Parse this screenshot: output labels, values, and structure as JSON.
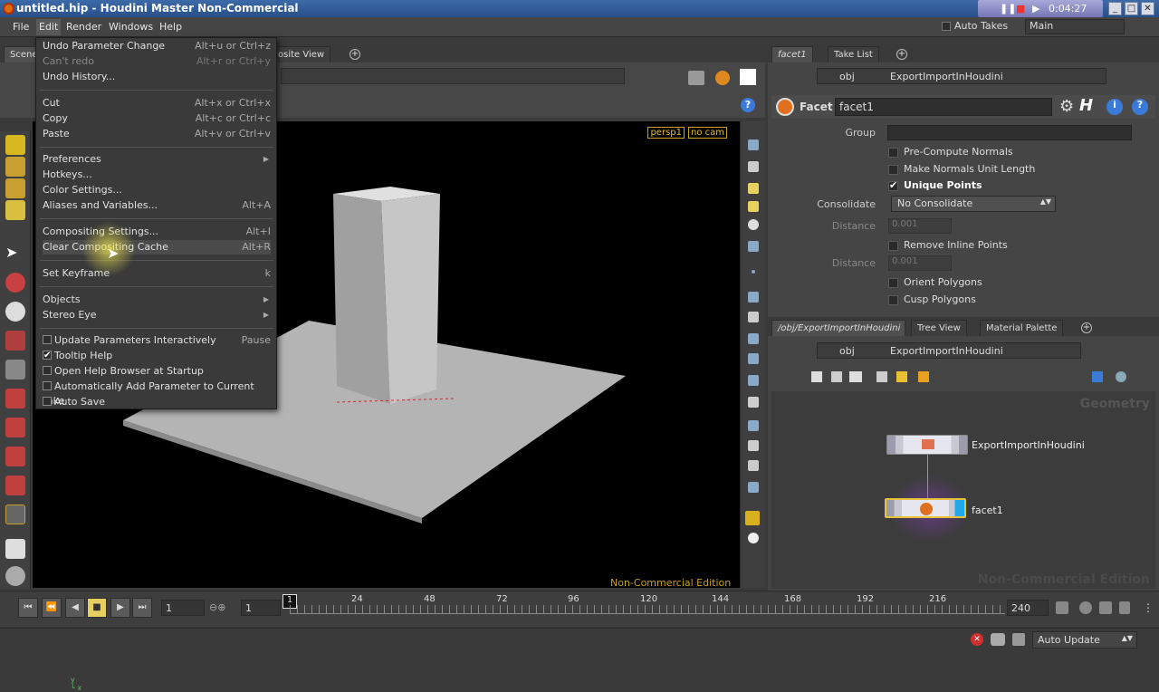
{
  "window": {
    "title": "untitled.hip - Houdini Master Non-Commercial",
    "timer": "0:04:27"
  },
  "menubar": {
    "items": [
      "File",
      "Edit",
      "Render",
      "Windows",
      "Help"
    ]
  },
  "toolbar": {
    "auto_takes": "Auto Takes",
    "desktop": "Main"
  },
  "left_tabs": {
    "scene": "Scene",
    "composite": "osite View"
  },
  "viewport": {
    "persp": "persp1",
    "cam": "no cam",
    "edition": "Non-Commercial Edition"
  },
  "edit_menu": {
    "items": [
      {
        "label": "Undo Parameter Change",
        "shortcut": "Alt+u or Ctrl+z"
      },
      {
        "label": "Can't redo",
        "shortcut": "Alt+r or Ctrl+y"
      },
      {
        "label": "Undo History...",
        "shortcut": ""
      },
      {
        "label": "Cut",
        "shortcut": "Alt+x or Ctrl+x"
      },
      {
        "label": "Copy",
        "shortcut": "Alt+c or Ctrl+c"
      },
      {
        "label": "Paste",
        "shortcut": "Alt+v or Ctrl+v"
      },
      {
        "label": "Preferences",
        "shortcut": ""
      },
      {
        "label": "Hotkeys...",
        "shortcut": ""
      },
      {
        "label": "Color Settings...",
        "shortcut": ""
      },
      {
        "label": "Aliases and Variables...",
        "shortcut": "Alt+A"
      },
      {
        "label": "Compositing Settings...",
        "shortcut": "Alt+I"
      },
      {
        "label": "Clear Compositing Cache",
        "shortcut": "Alt+R"
      },
      {
        "label": "Set Keyframe",
        "shortcut": "k"
      },
      {
        "label": "Objects",
        "shortcut": ""
      },
      {
        "label": "Stereo Eye",
        "shortcut": ""
      },
      {
        "label": "Update Parameters Interactively",
        "shortcut": "Pause"
      },
      {
        "label": "Tooltip Help",
        "shortcut": ""
      },
      {
        "label": "Open Help Browser at Startup",
        "shortcut": ""
      },
      {
        "label": "Automatically Add Parameter to Current Take",
        "shortcut": ""
      },
      {
        "label": "Auto Save",
        "shortcut": ""
      }
    ]
  },
  "param_pane": {
    "tabs": [
      "facet1",
      "Take List"
    ],
    "path_root": "obj",
    "path_node": "ExportImportInHoudini",
    "node_type": "Facet",
    "node_name": "facet1",
    "group_label": "Group",
    "pre_compute_normals": "Pre-Compute Normals",
    "make_normals_unit": "Make Normals Unit Length",
    "unique_points": "Unique Points",
    "consolidate_label": "Consolidate",
    "consolidate_value": "No Consolidate",
    "distance_label": "Distance",
    "distance_value": "0.001",
    "remove_inline": "Remove Inline Points",
    "orient_polygons": "Orient Polygons",
    "cusp_polygons": "Cusp Polygons"
  },
  "network_pane": {
    "tabs": [
      "/obj/ExportImportInHoudini",
      "Tree View",
      "Material Palette"
    ],
    "path_root": "obj",
    "path_node": "ExportImportInHoudini",
    "context": "Geometry",
    "watermark": "Non-Commercial Edition",
    "nodes": [
      "ExportImportInHoudini",
      "facet1"
    ]
  },
  "timeline": {
    "start_frame": "1",
    "current_frame": "1",
    "marker": "1",
    "end_frame": "240",
    "ticks": [
      "24",
      "48",
      "72",
      "96",
      "120",
      "144",
      "168",
      "192",
      "216"
    ]
  },
  "status": {
    "update_mode": "Auto Update"
  }
}
